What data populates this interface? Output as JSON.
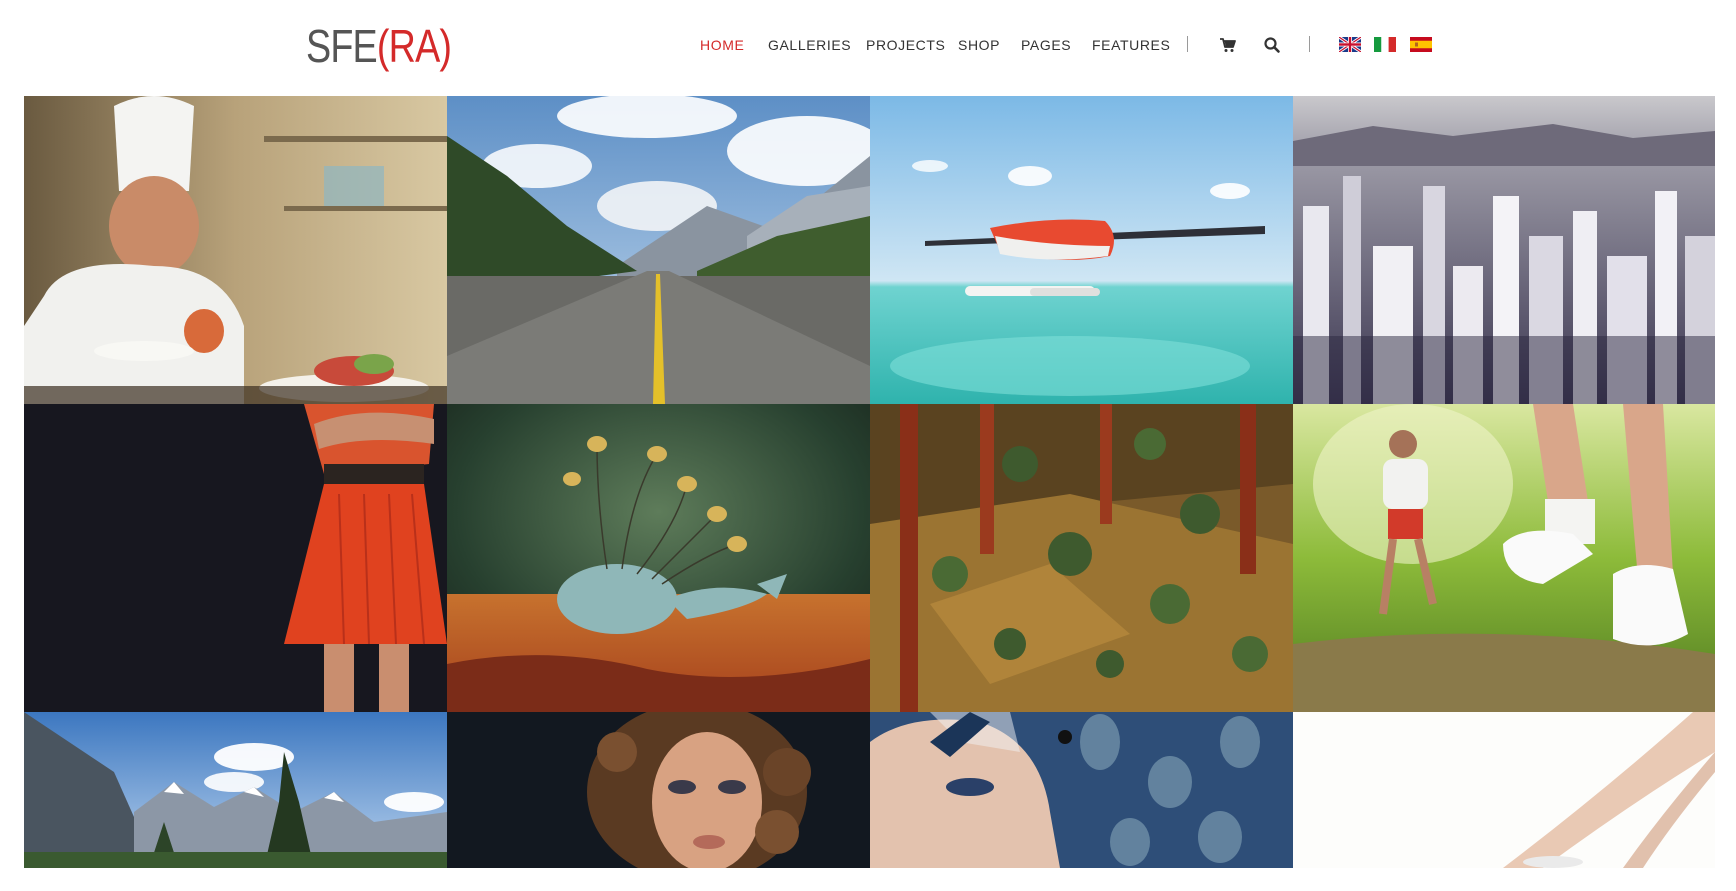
{
  "brand": {
    "logo_left": "SFE",
    "logo_right": "(RA)"
  },
  "nav": {
    "items": [
      {
        "label": "HOME",
        "active": true
      },
      {
        "label": "GALLERIES",
        "active": false
      },
      {
        "label": "PROJECTS",
        "active": false
      },
      {
        "label": "SHOP",
        "active": false
      },
      {
        "label": "PAGES",
        "active": false
      },
      {
        "label": "FEATURES",
        "active": false
      }
    ],
    "icons": [
      "cart-icon",
      "search-icon"
    ],
    "languages": [
      "flag-uk-icon",
      "flag-italy-icon",
      "flag-spain-icon"
    ]
  },
  "colors": {
    "accent": "#d42a2a",
    "text": "#333333",
    "logo_dark": "#555555"
  },
  "gallery": {
    "tiles": [
      "photo-chef-plating",
      "photo-mountain-road",
      "photo-seaplane-lagoon",
      "photo-city-skyline",
      "photo-red-dress",
      "photo-flying-whale-painting",
      "photo-lowpoly-forest",
      "photo-runner-trail",
      "photo-mountain-lake",
      "photo-curly-hair-portrait",
      "photo-feather-hat-portrait",
      "photo-legs-bright"
    ]
  }
}
